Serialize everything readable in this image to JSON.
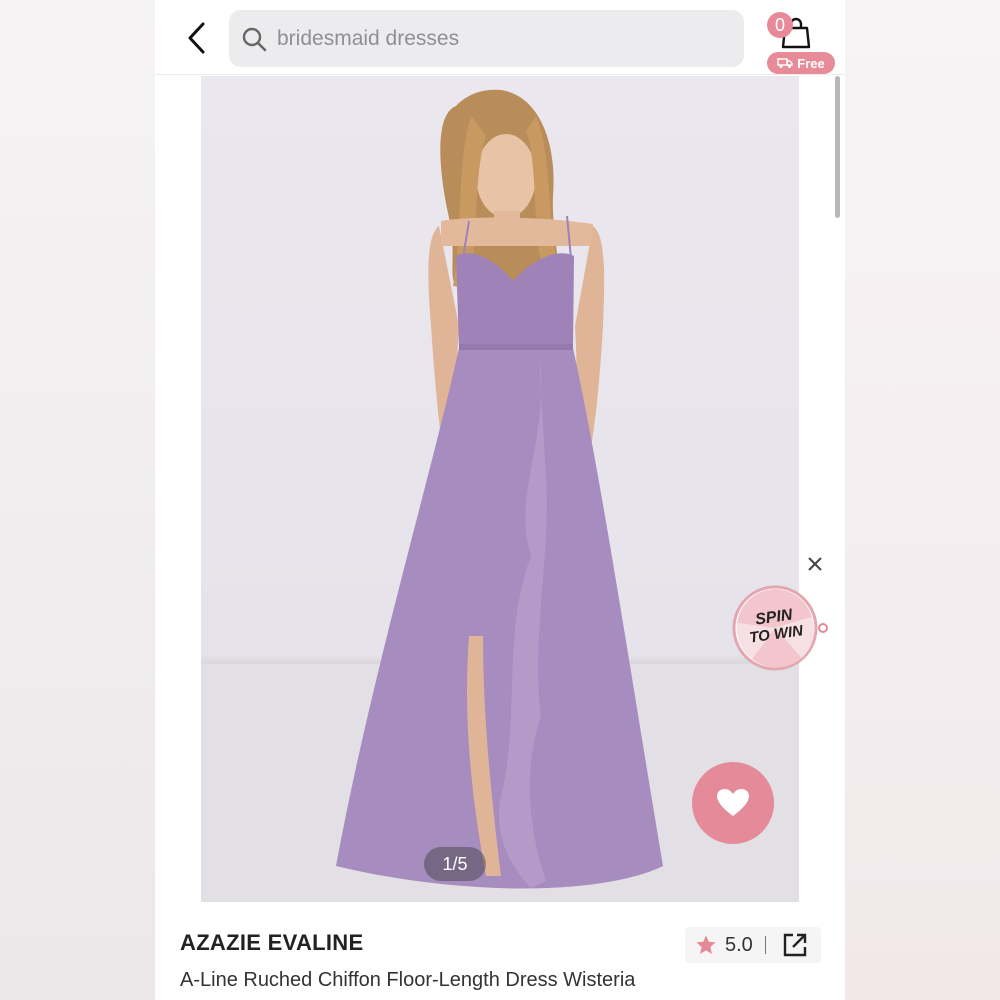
{
  "header": {
    "search": {
      "value": "bridesmaid dresses",
      "placeholder": "bridesmaid dresses"
    },
    "cart": {
      "count": "0",
      "free_label": "Free"
    }
  },
  "gallery": {
    "counter": "1/5",
    "spin": {
      "line1": "SPIN",
      "line2": "TO WIN"
    }
  },
  "product": {
    "brand": "AZAZIE EVALINE",
    "subtitle": "A-Line Ruched Chiffon Floor-Length Dress Wisteria",
    "rating": "5.0"
  },
  "icons": {
    "back": "chevron-left-icon",
    "search": "search-icon",
    "cart": "shopping-bag-icon",
    "shipping": "truck-icon",
    "close": "close-icon",
    "favorite": "heart-icon",
    "star": "star-icon",
    "share": "share-icon"
  },
  "colors": {
    "accent": "#e58a98",
    "dress": "#a78cbf",
    "search_bg": "#ececee"
  }
}
